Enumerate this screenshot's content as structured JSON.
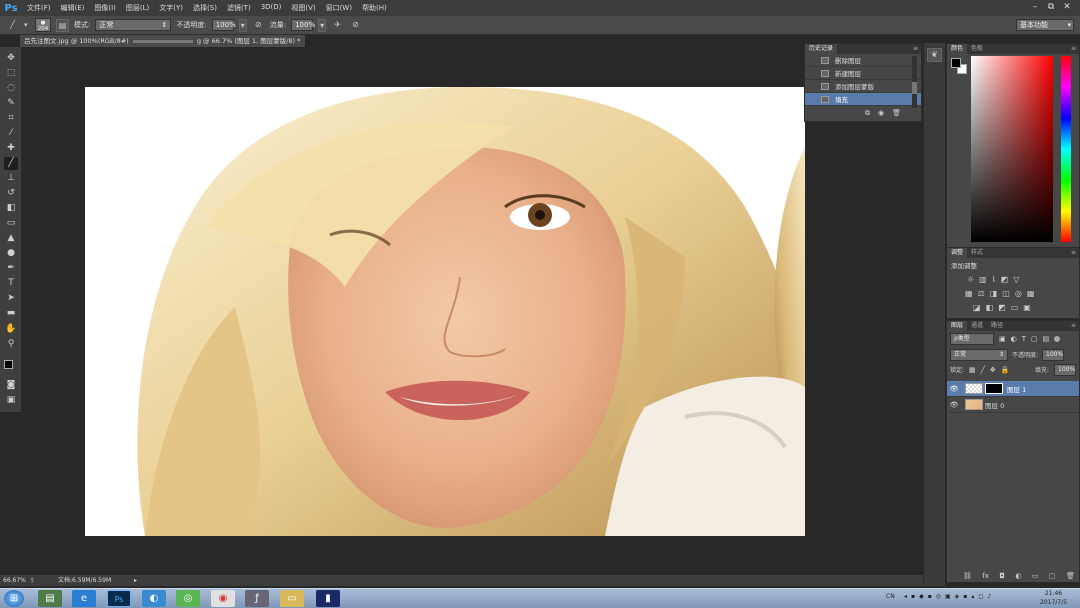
{
  "app": {
    "logo": "Ps"
  },
  "menu": [
    "文件(F)",
    "编辑(E)",
    "图像(I)",
    "图层(L)",
    "文字(Y)",
    "选择(S)",
    "滤镜(T)",
    "3D(D)",
    "视图(V)",
    "窗口(W)",
    "帮助(H)"
  ],
  "window_controls": {
    "minimize": "–",
    "restore": "⧉",
    "close": "✕"
  },
  "options": {
    "brush_size": "204",
    "mode_label": "模式:",
    "mode_value": "正常",
    "opacity_label": "不透明度:",
    "opacity_value": "100%",
    "flow_label": "流量:",
    "flow_value": "100%",
    "workspace": "基本功能"
  },
  "document": {
    "tab_title": "吕先注图文.jpg @ 100%(RGB/8#)",
    "tab2_title": "g @ 66.7% (图层 1, 图层蒙版/8) *",
    "close": "×"
  },
  "status": {
    "zoom": "66.67%",
    "doc_info": "文档:6.59M/6.59M"
  },
  "history": {
    "tabs": [
      "历史记录"
    ],
    "items": [
      {
        "label": "删除图层",
        "selected": false
      },
      {
        "label": "新建图层",
        "selected": false
      },
      {
        "label": "添加图层蒙版",
        "selected": false
      },
      {
        "label": "填充",
        "selected": true
      }
    ]
  },
  "color_panel": {
    "tabs": [
      "颜色",
      "色板"
    ],
    "fg": "#000000",
    "bg": "#ffffff"
  },
  "adjustments": {
    "tabs": [
      "调整",
      "样式"
    ],
    "title": "添加调整"
  },
  "layers": {
    "tabs": [
      "图层",
      "通道",
      "路径"
    ],
    "filter": "ρ类型",
    "blend_mode": "正常",
    "opacity_label": "不透明度:",
    "opacity_value": "100%",
    "lock_label": "锁定:",
    "fill_label": "填充:",
    "fill_value": "100%",
    "items": [
      {
        "name": "图层 1",
        "selected": true,
        "has_mask": true
      },
      {
        "name": "图层 0",
        "selected": false,
        "has_mask": false
      }
    ]
  },
  "taskbar": {
    "tray_lang": "CN",
    "time": "21:46",
    "date": "2017/7/5"
  }
}
